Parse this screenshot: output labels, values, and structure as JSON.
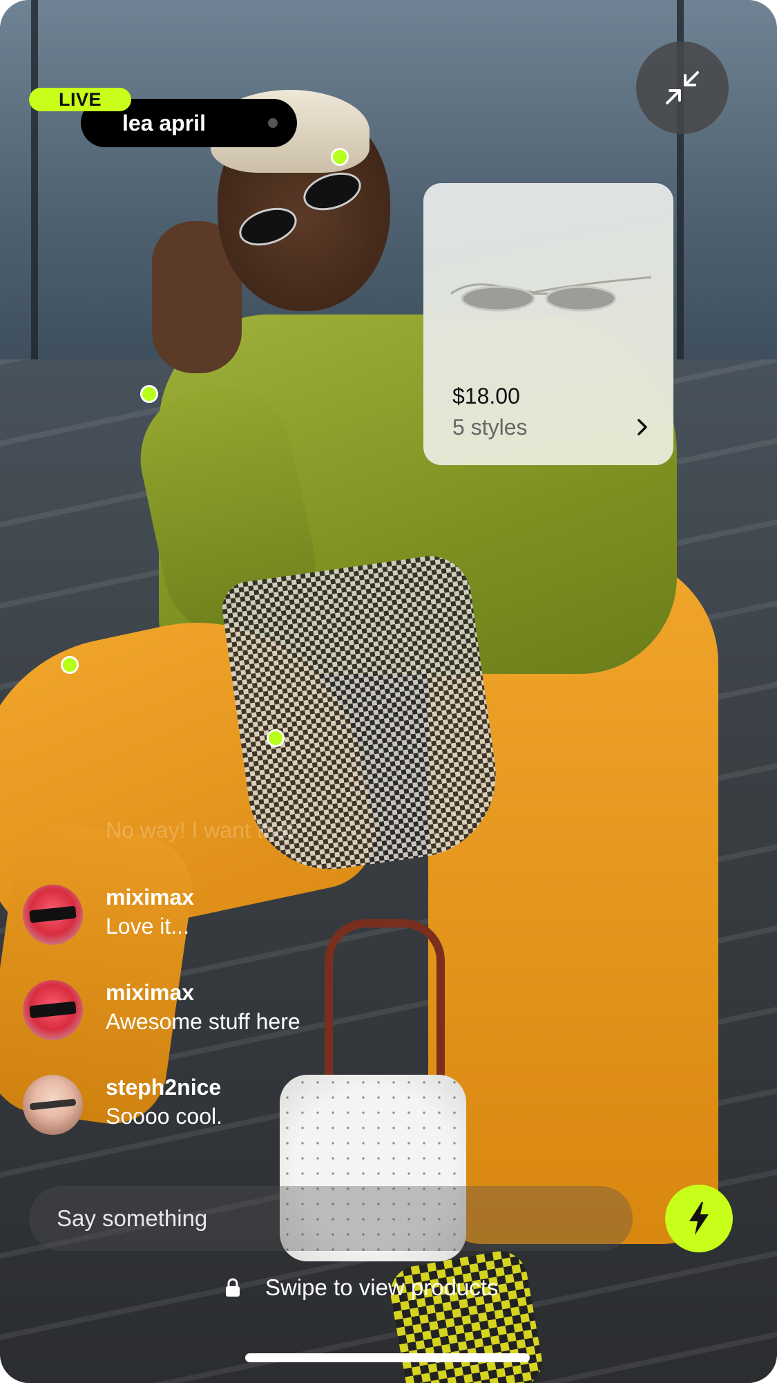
{
  "stream": {
    "live_label": "LIVE",
    "streamer_name": "lea april"
  },
  "product": {
    "price": "$18.00",
    "styles": "5 styles"
  },
  "chat": {
    "faded_message": "No way! I want that",
    "messages": [
      {
        "user": "miximax",
        "text": "Love it..."
      },
      {
        "user": "miximax",
        "text": "Awesome stuff here"
      },
      {
        "user": "steph2nice",
        "text": "Soooo cool."
      }
    ]
  },
  "input": {
    "placeholder": "Say something"
  },
  "footer": {
    "swipe_text": "Swipe to view products"
  },
  "icons": {
    "collapse": "collapse-arrows-icon",
    "bolt": "lightning-bolt-icon",
    "lock": "lock-icon",
    "chevron": "chevron-right-icon"
  },
  "colors": {
    "accent": "#c7ff1a",
    "hotspot": "#b6ff1a",
    "pill": "#000000"
  }
}
